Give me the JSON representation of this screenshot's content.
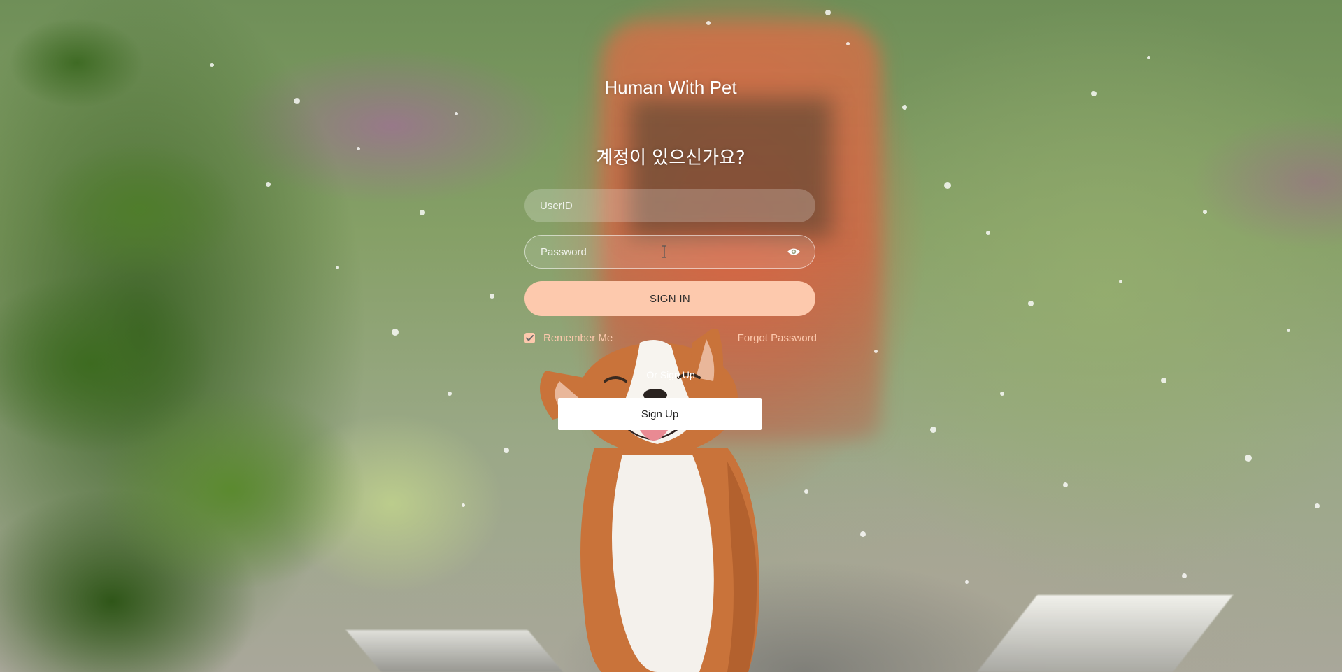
{
  "app": {
    "title": "Human With Pet"
  },
  "login": {
    "heading": "계정이 있으신가요?",
    "userid_placeholder": "UserID",
    "userid_value": "",
    "password_placeholder": "Password",
    "password_value": "",
    "signin_label": "SIGN IN",
    "remember_label": "Remember Me",
    "remember_checked": true,
    "forgot_label": "Forgot Password",
    "or_signup_label": "— Or Sign Up —",
    "signup_label": "Sign Up"
  },
  "icons": {
    "password_toggle": "eye-icon",
    "remember_check": "checkmark-icon"
  },
  "colors": {
    "accent": "#fdc9ad",
    "signup_bg": "#ffffff",
    "text": "#ffffff"
  }
}
